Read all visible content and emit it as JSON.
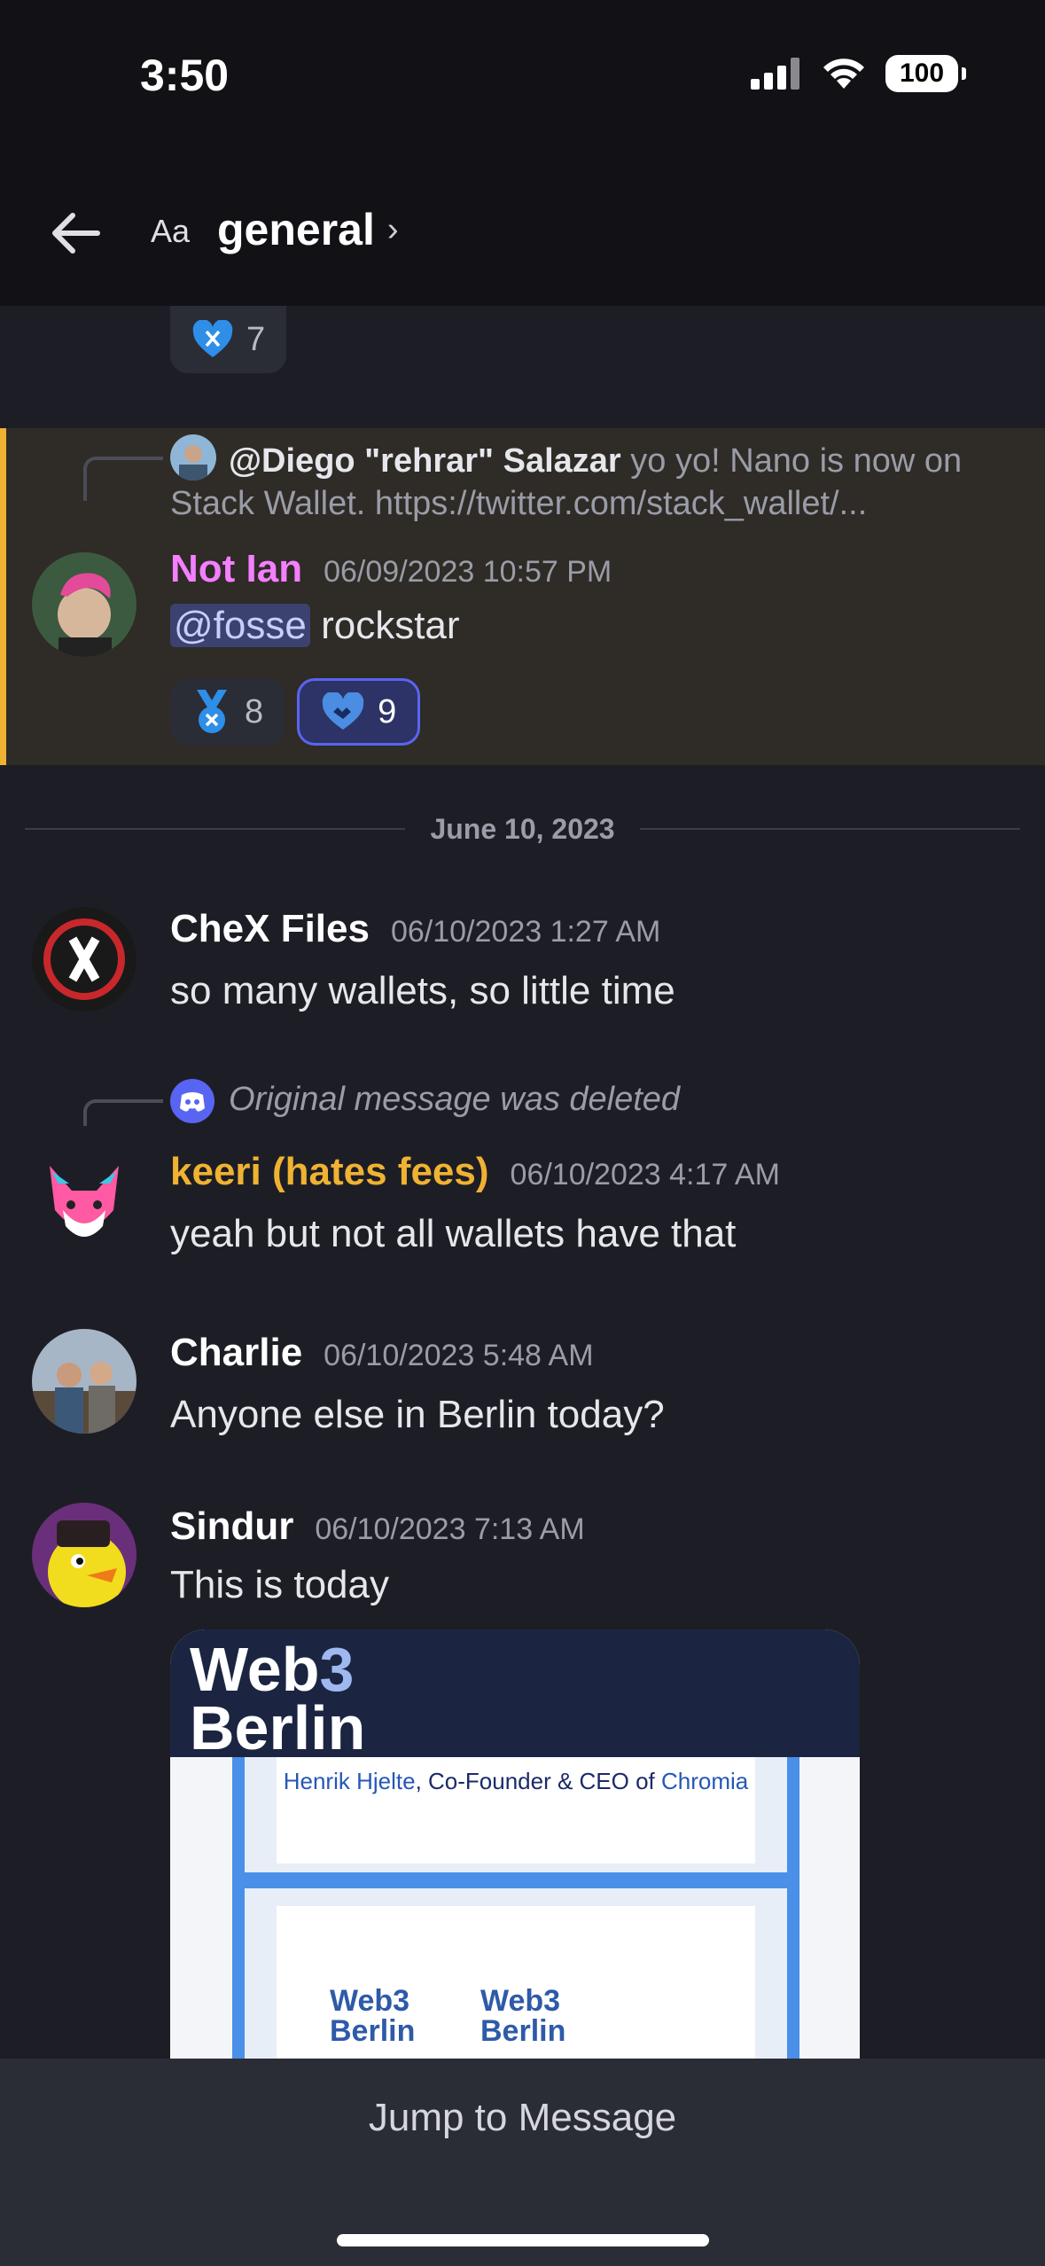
{
  "status_bar": {
    "time": "3:50",
    "battery": "100"
  },
  "header": {
    "font_toggle": "Aa",
    "channel": "general",
    "chevron": "›"
  },
  "top_reaction": {
    "count": "7"
  },
  "messages": [
    {
      "reply": {
        "author": "@Diego \"rehrar\" Salazar",
        "text": "yo yo! Nano is now on",
        "text2": "Stack Wallet. https://twitter.com/stack_wallet/..."
      },
      "author": "Not Ian",
      "author_color": "#f47fff",
      "time": "06/09/2023 10:57 PM",
      "mention": "@fosse",
      "text": " rockstar",
      "reactions": [
        {
          "count": "8"
        },
        {
          "count": "9"
        }
      ]
    },
    {
      "author": "CheX Files",
      "author_color": "#ffffff",
      "time": "06/10/2023 1:27 AM",
      "text": "so many wallets, so little time"
    },
    {
      "reply": {
        "text": "Original message was deleted"
      },
      "author": "keeri (hates fees)",
      "author_color": "#f0b232",
      "time": "06/10/2023 4:17 AM",
      "text": "yeah but not all wallets have that"
    },
    {
      "author": "Charlie",
      "author_color": "#ffffff",
      "time": "06/10/2023 5:48 AM",
      "text": "Anyone else in Berlin today?"
    },
    {
      "author": "Sindur",
      "author_color": "#ffffff",
      "time": "06/10/2023 7:13 AM",
      "text": "This is today"
    }
  ],
  "date_divider": "June 10, 2023",
  "embed": {
    "logo_line1": "Web",
    "logo_3": "3",
    "logo_line2": "Berlin",
    "caption_name": "Henrik Hjelte",
    "caption_mid": ", Co-Founder & CEO of ",
    "caption_org": "Chromia",
    "mini_logo_a1": "Web3",
    "mini_logo_a2": "Berlin",
    "mini_logo_b1": "Web3",
    "mini_logo_b2": "Berlin"
  },
  "jump_label": "Jump to Message",
  "colors": {
    "accent": "#5865f2",
    "highlight_bar": "#f0b232"
  }
}
